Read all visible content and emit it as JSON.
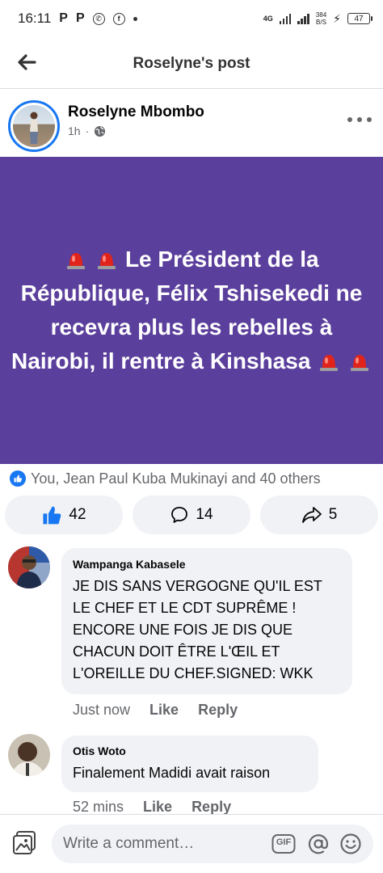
{
  "status_bar": {
    "time": "16:11",
    "notif_icons": [
      "P",
      "P"
    ],
    "network": "4G",
    "speed_value": "384",
    "speed_unit": "B/S",
    "battery": "47"
  },
  "header": {
    "title": "Roselyne's post"
  },
  "post": {
    "author": "Roselyne Mbombo",
    "time": "1h",
    "privacy_separator": "·",
    "background_color": "#5b3f9c",
    "text": "Le Président de la République, Félix Tshisekedi ne recevra plus les rebelles à Nairobi, il rentre à Kinshasa"
  },
  "reactions": {
    "summary": "You, Jean Paul Kuba Mukinayi and 40 others"
  },
  "actions": {
    "like_count": "42",
    "comment_count": "14",
    "share_count": "5"
  },
  "comments": [
    {
      "author": "Wampanga Kabasele",
      "text": "JE DIS SANS VERGOGNE QU'IL EST LE CHEF ET LE CDT SUPRÊME ! ENCORE UNE FOIS JE DIS QUE CHACUN DOIT ÊTRE L'ŒIL ET L'OREILLE DU CHEF.SIGNED: WKK",
      "time": "Just now",
      "like_label": "Like",
      "reply_label": "Reply"
    },
    {
      "author": "Otis Woto",
      "text": "Finalement Madidi avait raison",
      "time": "52 mins",
      "like_label": "Like",
      "reply_label": "Reply"
    }
  ],
  "composer": {
    "placeholder": "Write a comment…",
    "gif_label": "GIF"
  },
  "colors": {
    "accent": "#1877f2",
    "post_bg": "#5b3f9c",
    "bubble_bg": "#f0f2f5",
    "muted_text": "#65676b"
  },
  "icons": [
    "back-arrow-icon",
    "globe-icon",
    "more-dots-icon",
    "siren-icon",
    "like-icon",
    "comment-icon",
    "share-icon",
    "photo-icon",
    "gif-icon",
    "at-icon",
    "emoji-icon"
  ]
}
